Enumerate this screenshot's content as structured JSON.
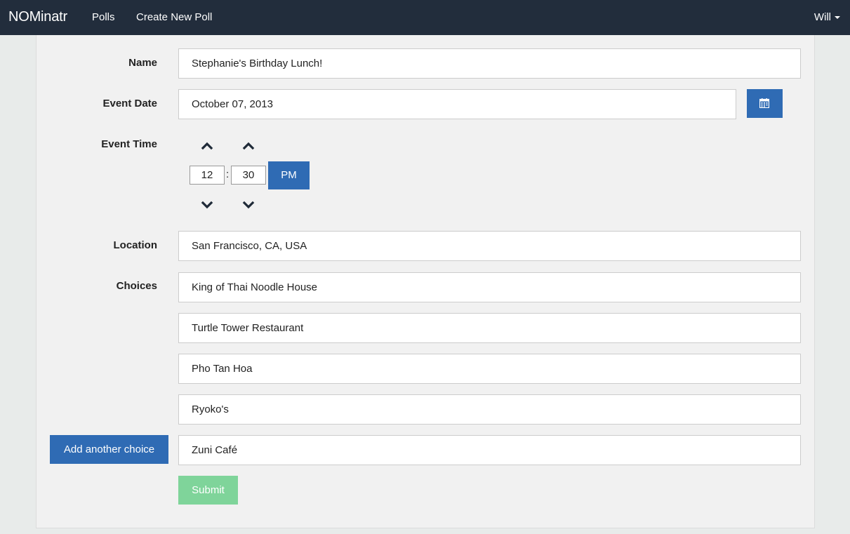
{
  "nav": {
    "brand": "NOMinatr",
    "links": [
      "Polls",
      "Create New Poll"
    ],
    "user": "Will"
  },
  "form": {
    "name_label": "Name",
    "name_value": "Stephanie's Birthday Lunch!",
    "date_label": "Event Date",
    "date_value": "October 07, 2013",
    "time_label": "Event Time",
    "hour": "12",
    "minute": "30",
    "meridian": "PM",
    "location_label": "Location",
    "location_value": "San Francisco, CA, USA",
    "choices_label": "Choices",
    "choices": [
      "King of Thai Noodle House",
      "Turtle Tower Restaurant",
      "Pho Tan Hoa",
      "Ryoko's",
      "Zuni Café"
    ],
    "add_choice_label": "Add another choice",
    "submit_label": "Submit"
  },
  "icons": {
    "calendar": "calendar-icon",
    "up": "chevron-up-icon",
    "down": "chevron-down-icon",
    "caret": "caret-down-icon"
  },
  "colors": {
    "navbar": "#222d3c",
    "primary": "#2f6bb4",
    "success": "#7fd49a",
    "panel": "#f1f1f1",
    "page": "#e8ebea"
  }
}
